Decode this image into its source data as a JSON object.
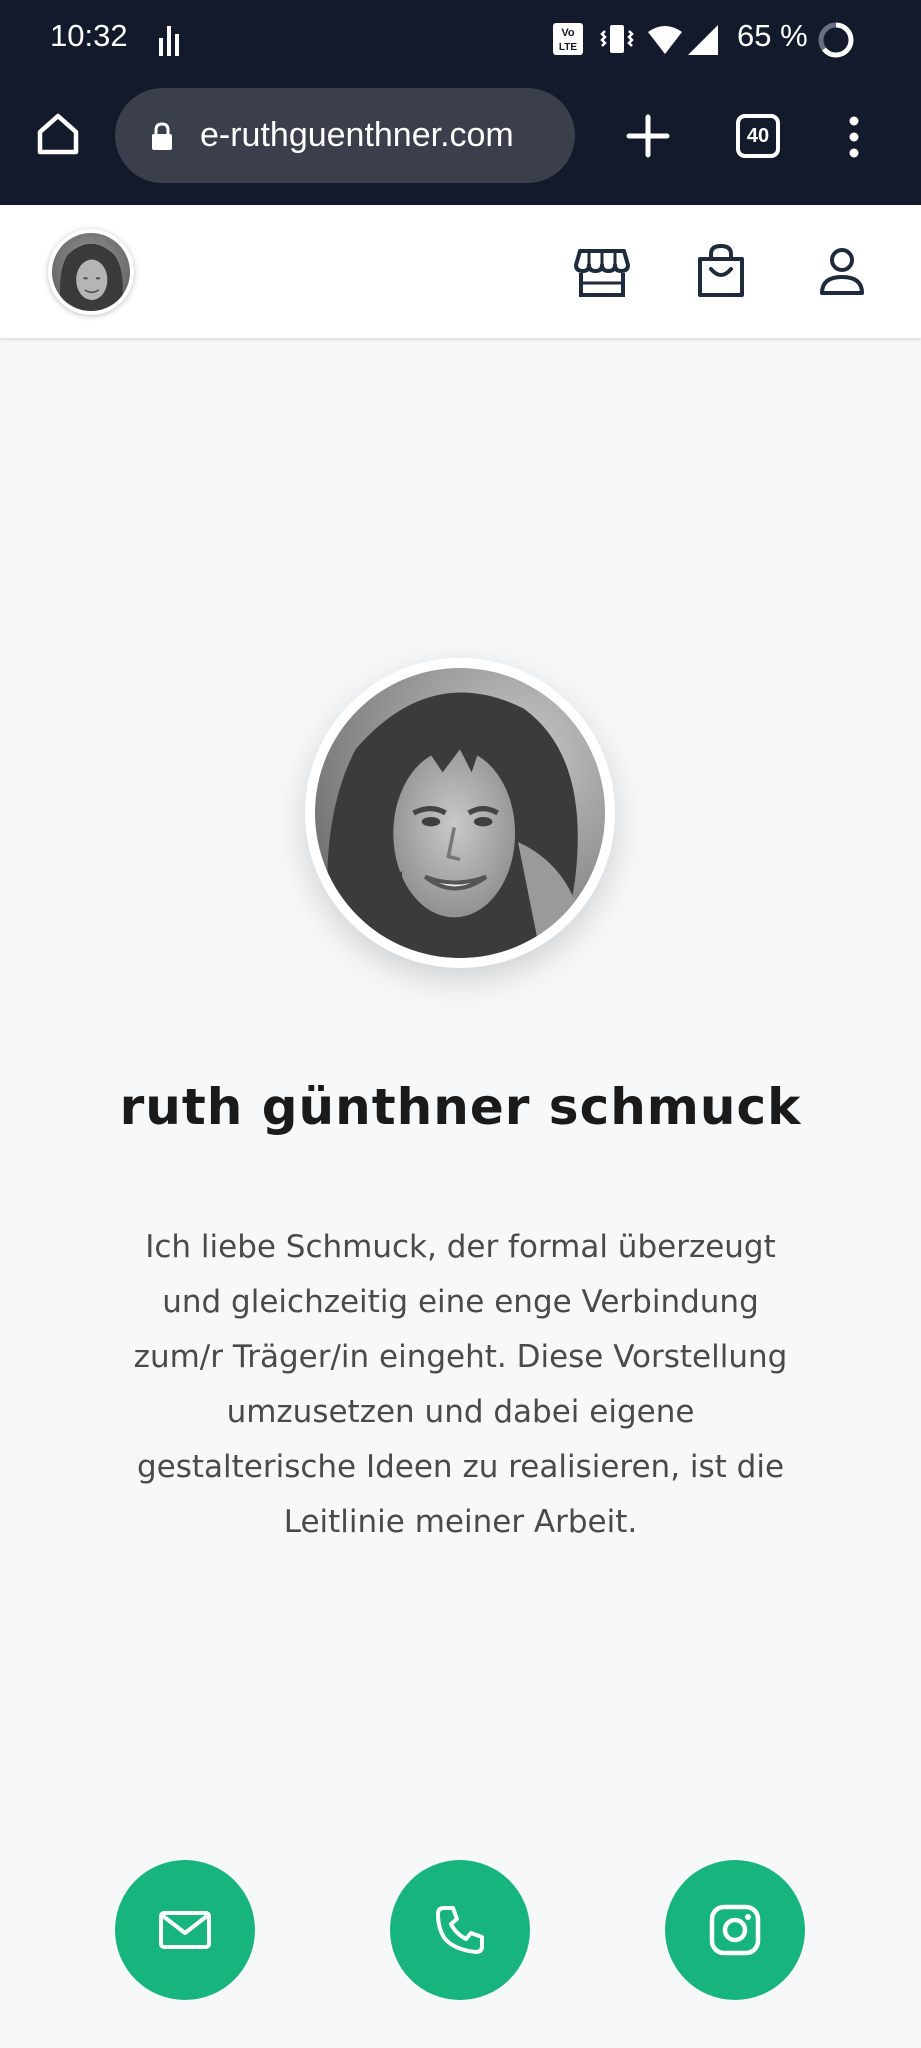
{
  "status_bar": {
    "time": "10:32",
    "battery": "65 %",
    "icons": [
      "activity-bars-icon",
      "volte-icon",
      "vibrate-icon",
      "wifi-icon",
      "cell-signal-icon",
      "battery-ring-icon"
    ]
  },
  "browser": {
    "url": "e-ruthguenthner.com",
    "tab_count": "40",
    "icons": [
      "home-icon",
      "lock-icon",
      "new-tab-icon",
      "more-menu-icon"
    ]
  },
  "header": {
    "icons": [
      "shop-icon",
      "shopping-bag-icon",
      "user-icon"
    ]
  },
  "main": {
    "title": "ruth günthner schmuck",
    "intro_lines": [
      "Ich liebe Schmuck, der formal überzeugt",
      "und gleichzeitig eine enge Verbindung",
      "zum/r Träger/in eingeht. Diese Vorstellung",
      "umzusetzen und dabei eigene",
      "gestalterische Ideen zu realisieren, ist die",
      "Leitlinie meiner Arbeit."
    ]
  },
  "contact": {
    "icons": [
      "mail-icon",
      "phone-icon",
      "instagram-icon"
    ]
  },
  "colors": {
    "system_bar": "#131a2b",
    "url_field": "#3a3f4b",
    "page_background": "#f7f8fa",
    "accent_green": "#17b57d",
    "title_text": "#1a1a1a",
    "body_text": "#4a4a4a"
  }
}
